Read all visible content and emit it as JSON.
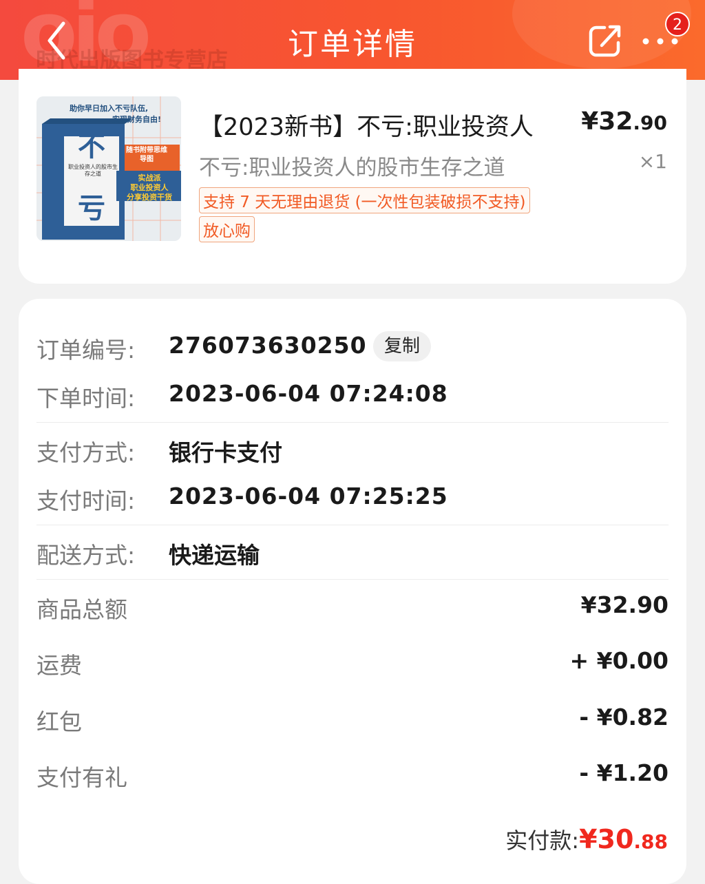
{
  "header": {
    "title": "订单详情",
    "store_name": "时代出版图书专营店",
    "badge_count": "2",
    "accent": "#f44a3e"
  },
  "product": {
    "cover_texts": {
      "top_slogan_1": "助你早日加入不亏队伍,",
      "top_slogan_2": "实现财务自由!",
      "title_big_1": "不",
      "title_big_2": "亏",
      "subtitle": "职业投资人的股市生存之道",
      "sticker": "随书附带思维导图",
      "side_1": "实战派",
      "side_2": "职业投资人",
      "side_3": "分享投资干货"
    },
    "name": "【2023新书】不亏:职业投资人",
    "price_main": "¥32",
    "price_cents": ".90",
    "subtitle": "不亏:职业投资人的股市生存之道",
    "quantity": "×1",
    "tags": [
      "支持 7 天无理由退货 (一次性包装破损不支持)",
      "放心购"
    ]
  },
  "order": {
    "order_no_label": "订单编号:",
    "order_no": "276073630250",
    "copy_label": "复制",
    "order_time_label": "下单时间:",
    "order_time": "2023-06-04 07:24:08",
    "pay_method_label": "支付方式:",
    "pay_method": "银行卡支付",
    "pay_time_label": "支付时间:",
    "pay_time": "2023-06-04 07:25:25",
    "delivery_label": "配送方式:",
    "delivery": "快递运输"
  },
  "amounts": {
    "goods_total_label": "商品总额",
    "goods_total": "¥32.90",
    "shipping_label": "运费",
    "shipping": "+ ¥0.00",
    "red_packet_label": "红包",
    "red_packet": "- ¥0.82",
    "pay_gift_label": "支付有礼",
    "pay_gift": "- ¥1.20",
    "paid_label": "实付款:",
    "paid_main": "¥30",
    "paid_cents": ".88",
    "paid_color": "#f0281e"
  }
}
